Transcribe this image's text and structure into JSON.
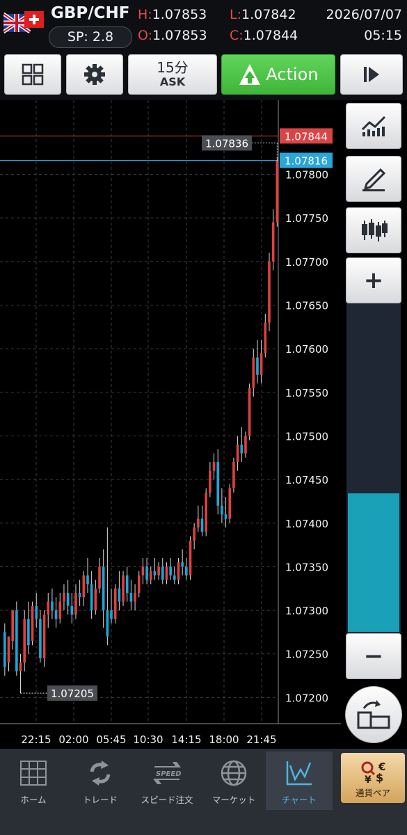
{
  "header": {
    "pair": "GBP/CHF",
    "spread_label": "SP: 2.8",
    "high_key": "H:",
    "high_val": "1.07853",
    "open_key": "O:",
    "open_val": "1.07853",
    "low_key": "L:",
    "low_val": "1.07842",
    "close_key": "C:",
    "close_val": "1.07844",
    "date": "2026/07/07",
    "time": "05:15"
  },
  "toolbar": {
    "timeframe": "15分",
    "price_side": "ASK",
    "action_label": "Action"
  },
  "chart_data": {
    "type": "candlestick",
    "ylim": [
      1.0717,
      1.07885
    ],
    "y_ticks": [
      "1.07200",
      "1.07250",
      "1.07300",
      "1.07350",
      "1.07400",
      "1.07450",
      "1.07500",
      "1.07550",
      "1.07600",
      "1.07650",
      "1.07700",
      "1.07750",
      "1.07800"
    ],
    "x_ticks": [
      "22:15",
      "02:00",
      "05:45",
      "10:30",
      "14:15",
      "18:00",
      "21:45"
    ],
    "ask_line": "1.07844",
    "bid_line": "1.07816",
    "high_marker": "1.07836",
    "low_marker": "1.07205",
    "candles": [
      [
        1.07275,
        1.07285,
        1.07235,
        1.07225
      ],
      [
        1.0724,
        1.0727,
        1.0727,
        1.0723
      ],
      [
        1.07265,
        1.073,
        1.073,
        1.07255
      ],
      [
        1.073,
        1.0731,
        1.0723,
        1.07225
      ],
      [
        1.0723,
        1.0725,
        1.0724,
        1.07205
      ],
      [
        1.0724,
        1.073,
        1.0729,
        1.0723
      ],
      [
        1.0729,
        1.0731,
        1.0726,
        1.0725
      ],
      [
        1.07265,
        1.0731,
        1.07305,
        1.0726
      ],
      [
        1.07305,
        1.0732,
        1.0729,
        1.0728
      ],
      [
        1.0729,
        1.073,
        1.07245,
        1.0724
      ],
      [
        1.07245,
        1.073,
        1.07295,
        1.07235
      ],
      [
        1.07295,
        1.0732,
        1.0731,
        1.0728
      ],
      [
        1.0731,
        1.07325,
        1.073,
        1.0729
      ],
      [
        1.073,
        1.07315,
        1.0729,
        1.0728
      ],
      [
        1.0729,
        1.0732,
        1.0731,
        1.07285
      ],
      [
        1.0731,
        1.0733,
        1.0732,
        1.073
      ],
      [
        1.0732,
        1.07335,
        1.07305,
        1.07295
      ],
      [
        1.07305,
        1.0732,
        1.07295,
        1.07285
      ],
      [
        1.07295,
        1.0733,
        1.0732,
        1.0729
      ],
      [
        1.0732,
        1.07335,
        1.07315,
        1.07305
      ],
      [
        1.07315,
        1.07345,
        1.0734,
        1.07305
      ],
      [
        1.0734,
        1.0736,
        1.0733,
        1.0732
      ],
      [
        1.0733,
        1.07345,
        1.073,
        1.0729
      ],
      [
        1.073,
        1.07335,
        1.07325,
        1.07295
      ],
      [
        1.07325,
        1.0736,
        1.0735,
        1.0732
      ],
      [
        1.0735,
        1.0737,
        1.073,
        1.0728
      ],
      [
        1.073,
        1.07395,
        1.0727,
        1.0726
      ],
      [
        1.073,
        1.07325,
        1.0729,
        1.07285
      ],
      [
        1.0729,
        1.0733,
        1.07325,
        1.07285
      ],
      [
        1.07325,
        1.07345,
        1.0731,
        1.073
      ],
      [
        1.0731,
        1.07345,
        1.0734,
        1.07305
      ],
      [
        1.0734,
        1.0735,
        1.0732,
        1.0731
      ],
      [
        1.0732,
        1.07335,
        1.0731,
        1.073
      ],
      [
        1.0731,
        1.0733,
        1.0732,
        1.073
      ],
      [
        1.0732,
        1.07345,
        1.0734,
        1.07315
      ],
      [
        1.0734,
        1.0736,
        1.0735,
        1.0733
      ],
      [
        1.0735,
        1.0736,
        1.07335,
        1.0733
      ],
      [
        1.07335,
        1.0735,
        1.07345,
        1.0733
      ],
      [
        1.07345,
        1.0736,
        1.0734,
        1.07335
      ],
      [
        1.0734,
        1.07355,
        1.0735,
        1.07335
      ],
      [
        1.0735,
        1.0736,
        1.07335,
        1.0733
      ],
      [
        1.07335,
        1.07355,
        1.0735,
        1.0733
      ],
      [
        1.0735,
        1.0736,
        1.0734,
        1.07335
      ],
      [
        1.0734,
        1.0735,
        1.07335,
        1.0733
      ],
      [
        1.07335,
        1.0736,
        1.07355,
        1.0733
      ],
      [
        1.07355,
        1.0737,
        1.0735,
        1.0734
      ],
      [
        1.0735,
        1.0736,
        1.0734,
        1.07335
      ],
      [
        1.0734,
        1.07385,
        1.0738,
        1.07335
      ],
      [
        1.0738,
        1.074,
        1.07395,
        1.0737
      ],
      [
        1.07395,
        1.0742,
        1.07405,
        1.0739
      ],
      [
        1.07405,
        1.0742,
        1.0739,
        1.07385
      ],
      [
        1.0739,
        1.0744,
        1.07435,
        1.07385
      ],
      [
        1.07435,
        1.0747,
        1.0746,
        1.0743
      ],
      [
        1.0746,
        1.0748,
        1.0747,
        1.0745
      ],
      [
        1.0747,
        1.07485,
        1.0742,
        1.0741
      ],
      [
        1.0742,
        1.0744,
        1.0741,
        1.074
      ],
      [
        1.0741,
        1.0743,
        1.07405,
        1.07395
      ],
      [
        1.07405,
        1.07445,
        1.0744,
        1.074
      ],
      [
        1.0744,
        1.07475,
        1.0747,
        1.07435
      ],
      [
        1.0747,
        1.075,
        1.0749,
        1.0746
      ],
      [
        1.0749,
        1.0751,
        1.0748,
        1.0747
      ],
      [
        1.0748,
        1.07505,
        1.075,
        1.07475
      ],
      [
        1.075,
        1.0756,
        1.07555,
        1.07495
      ],
      [
        1.07555,
        1.076,
        1.0759,
        1.07545
      ],
      [
        1.0759,
        1.0761,
        1.0757,
        1.0756
      ],
      [
        1.0757,
        1.0761,
        1.07595,
        1.0756
      ],
      [
        1.07595,
        1.0764,
        1.0763,
        1.0759
      ],
      [
        1.0763,
        1.0771,
        1.077,
        1.0762
      ],
      [
        1.077,
        1.0776,
        1.07745,
        1.0769
      ],
      [
        1.07745,
        1.0782,
        1.07816,
        1.0774
      ]
    ]
  },
  "zoom": {
    "plus_label": "+",
    "minus_label": "−",
    "level": 0.42
  },
  "nav": [
    {
      "label": "ホーム",
      "icon": "home-grid-icon"
    },
    {
      "label": "トレード",
      "icon": "refresh-arrows-icon"
    },
    {
      "label": "スピード注文",
      "icon": "speed-arrows-icon"
    },
    {
      "label": "マーケット",
      "icon": "globe-icon"
    },
    {
      "label": "チャート",
      "icon": "line-chart-icon"
    },
    {
      "label": "通貨ペア",
      "icon": "currency-icon"
    }
  ],
  "colors": {
    "up": "#e04040",
    "down": "#1aa6d8",
    "ask_line": "#d94545",
    "bid_line": "#2aa6d8",
    "action": "#4ac445"
  }
}
